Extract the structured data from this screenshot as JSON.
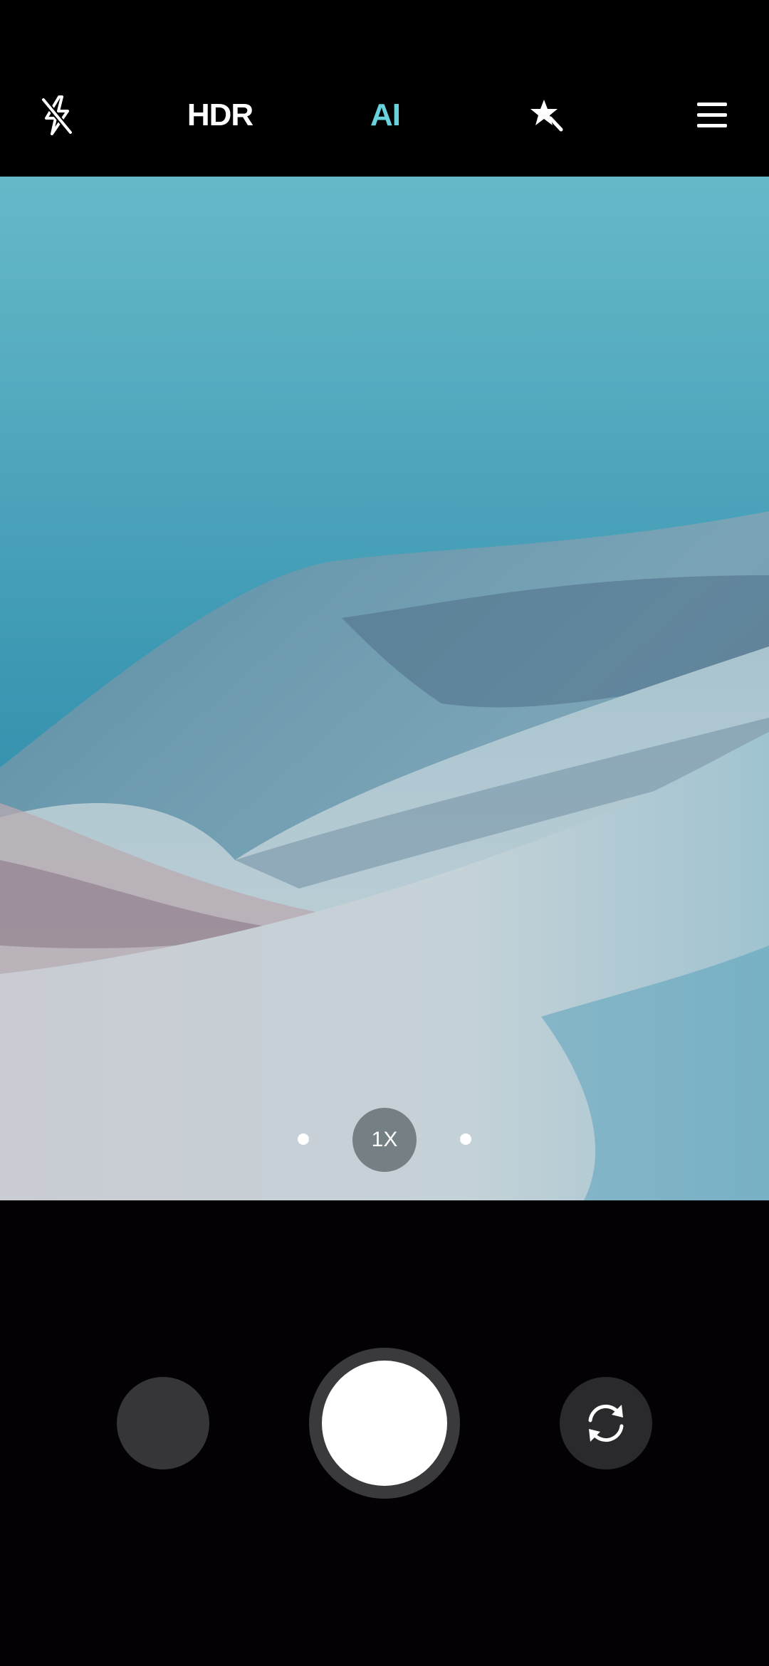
{
  "toolbar": {
    "flash_icon": "flash-off-icon",
    "hdr_label": "HDR",
    "ai_label": "AI",
    "beauty_icon": "magic-star-icon",
    "menu_icon": "hamburger-menu-icon"
  },
  "colors": {
    "background": "#000000",
    "ai_active": "#69d2dc",
    "shutter": "#ffffff",
    "shutter_ring": "#3a393c",
    "control_bg": "#2a292c"
  },
  "zoom": {
    "current_label": "1X"
  },
  "controls": {
    "gallery_icon": "gallery-thumbnail",
    "shutter_icon": "shutter-button",
    "switch_camera_icon": "switch-camera-icon"
  }
}
